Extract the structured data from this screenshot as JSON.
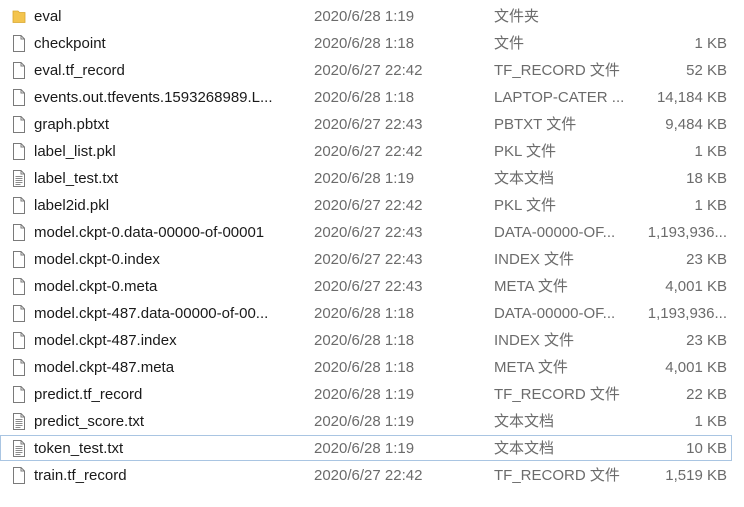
{
  "files": [
    {
      "name": "eval",
      "date": "2020/6/28 1:19",
      "type": "文件夹",
      "size": "",
      "icon": "folder-icon"
    },
    {
      "name": "checkpoint",
      "date": "2020/6/28 1:18",
      "type": "文件",
      "size": "1 KB",
      "icon": "file-icon"
    },
    {
      "name": "eval.tf_record",
      "date": "2020/6/27 22:42",
      "type": "TF_RECORD 文件",
      "size": "52 KB",
      "icon": "file-icon"
    },
    {
      "name": "events.out.tfevents.1593268989.L...",
      "date": "2020/6/28 1:18",
      "type": "LAPTOP-CATER ...",
      "size": "14,184 KB",
      "icon": "file-icon"
    },
    {
      "name": "graph.pbtxt",
      "date": "2020/6/27 22:43",
      "type": "PBTXT 文件",
      "size": "9,484 KB",
      "icon": "file-icon"
    },
    {
      "name": "label_list.pkl",
      "date": "2020/6/27 22:42",
      "type": "PKL 文件",
      "size": "1 KB",
      "icon": "file-icon"
    },
    {
      "name": "label_test.txt",
      "date": "2020/6/28 1:19",
      "type": "文本文档",
      "size": "18 KB",
      "icon": "text-file-icon"
    },
    {
      "name": "label2id.pkl",
      "date": "2020/6/27 22:42",
      "type": "PKL 文件",
      "size": "1 KB",
      "icon": "file-icon"
    },
    {
      "name": "model.ckpt-0.data-00000-of-00001",
      "date": "2020/6/27 22:43",
      "type": "DATA-00000-OF...",
      "size": "1,193,936...",
      "icon": "file-icon"
    },
    {
      "name": "model.ckpt-0.index",
      "date": "2020/6/27 22:43",
      "type": "INDEX 文件",
      "size": "23 KB",
      "icon": "file-icon"
    },
    {
      "name": "model.ckpt-0.meta",
      "date": "2020/6/27 22:43",
      "type": "META 文件",
      "size": "4,001 KB",
      "icon": "file-icon"
    },
    {
      "name": "model.ckpt-487.data-00000-of-00...",
      "date": "2020/6/28 1:18",
      "type": "DATA-00000-OF...",
      "size": "1,193,936...",
      "icon": "file-icon"
    },
    {
      "name": "model.ckpt-487.index",
      "date": "2020/6/28 1:18",
      "type": "INDEX 文件",
      "size": "23 KB",
      "icon": "file-icon"
    },
    {
      "name": "model.ckpt-487.meta",
      "date": "2020/6/28 1:18",
      "type": "META 文件",
      "size": "4,001 KB",
      "icon": "file-icon"
    },
    {
      "name": "predict.tf_record",
      "date": "2020/6/28 1:19",
      "type": "TF_RECORD 文件",
      "size": "22 KB",
      "icon": "file-icon"
    },
    {
      "name": "predict_score.txt",
      "date": "2020/6/28 1:19",
      "type": "文本文档",
      "size": "1 KB",
      "icon": "text-file-icon"
    },
    {
      "name": "token_test.txt",
      "date": "2020/6/28 1:19",
      "type": "文本文档",
      "size": "10 KB",
      "icon": "text-file-icon",
      "focused": true
    },
    {
      "name": "train.tf_record",
      "date": "2020/6/27 22:42",
      "type": "TF_RECORD 文件",
      "size": "1,519 KB",
      "icon": "file-icon"
    }
  ],
  "colors": {
    "folder": "#f3c44e",
    "focus_border": "#a9c5e2",
    "secondary_text": "#6b6b6b"
  }
}
